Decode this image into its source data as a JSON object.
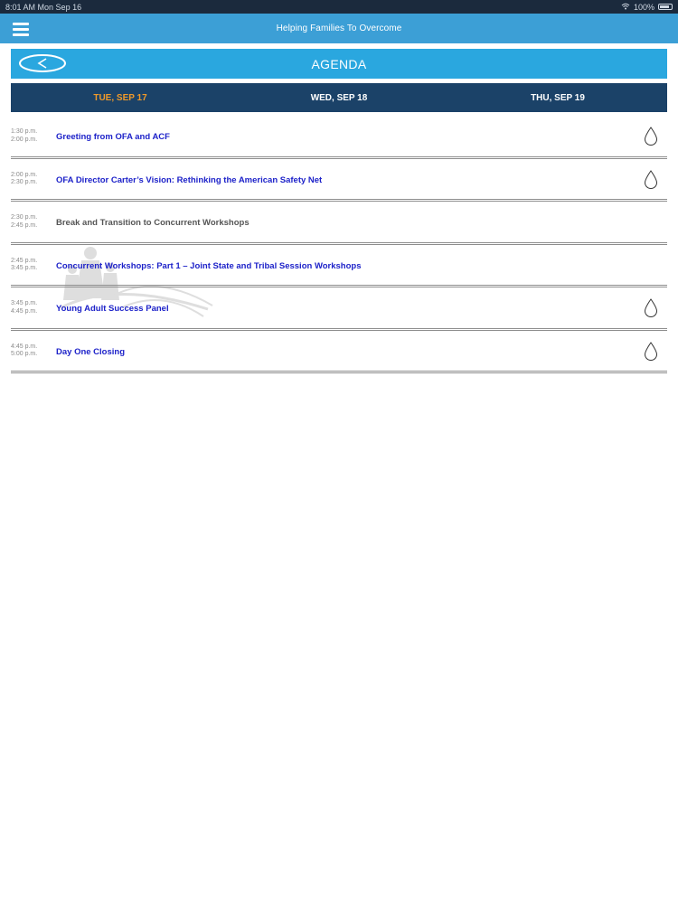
{
  "status_bar": {
    "time": "8:01 AM",
    "date": "Mon Sep 16",
    "battery": "100%"
  },
  "header": {
    "title": "Helping Families To Overcome"
  },
  "agenda": {
    "title": "AGENDA"
  },
  "tabs": [
    {
      "label": "TUE, SEP 17",
      "active": true
    },
    {
      "label": "WED, SEP 18",
      "active": false
    },
    {
      "label": "THU, SEP 19",
      "active": false
    }
  ],
  "sessions": [
    {
      "start": "1:30 p.m.",
      "end": "2:00 p.m.",
      "title": "Greeting from OFA and ACF",
      "linked": true,
      "icon": "drop-icon"
    },
    {
      "start": "2:00 p.m.",
      "end": "2:30 p.m.",
      "title": "OFA Director Carter’s Vision: Rethinking the American Safety Net",
      "linked": true,
      "icon": "drop-icon"
    },
    {
      "start": "2:30 p.m.",
      "end": "2:45 p.m.",
      "title": "Break and Transition to Concurrent Workshops",
      "linked": false,
      "icon": ""
    },
    {
      "start": "2:45 p.m.",
      "end": "3:45 p.m.",
      "title": "Concurrent Workshops: Part 1 – Joint State and Tribal Session Workshops",
      "linked": true,
      "icon": ""
    },
    {
      "start": "3:45 p.m.",
      "end": "4:45 p.m.",
      "title": "Young Adult Success Panel",
      "linked": true,
      "icon": "drop-icon"
    },
    {
      "start": "4:45 p.m.",
      "end": "5:00 p.m.",
      "title": "Day One Closing",
      "linked": true,
      "icon": "drop-icon"
    }
  ],
  "colors": {
    "header_bg": "#3c9fd6",
    "agenda_bg": "#2aa7df",
    "tabs_bg": "#1b4268",
    "active_tab": "#f09a2a",
    "session_link": "#1d22c9"
  }
}
